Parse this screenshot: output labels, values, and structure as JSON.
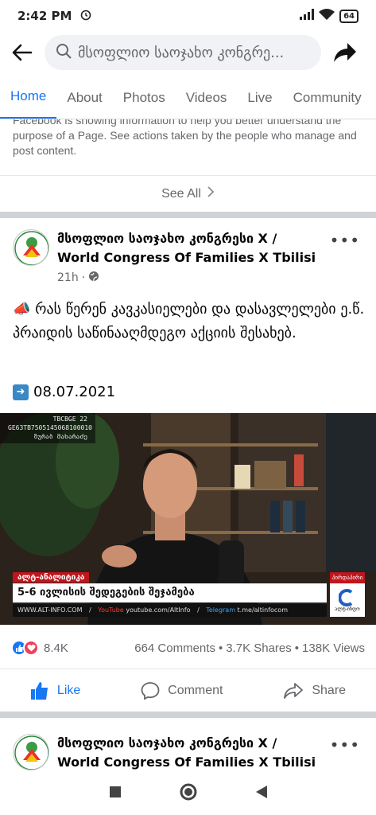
{
  "status": {
    "time": "2:42 PM",
    "battery": "64"
  },
  "search": {
    "query": "მსოფლიო საოჯახო კონგრე..."
  },
  "tabs": [
    {
      "label": "Home",
      "active": true
    },
    {
      "label": "About"
    },
    {
      "label": "Photos"
    },
    {
      "label": "Videos"
    },
    {
      "label": "Live"
    },
    {
      "label": "Community"
    }
  ],
  "info": {
    "partial_line": "Facebook is showing information to help you better understand the",
    "text": "purpose of a Page. See actions taken by the people who manage and post content."
  },
  "see_all": "See All",
  "post": {
    "page_name_line1": "მსოფლიო საოჯახო კონგრესი X /",
    "page_name_line2": "World Congress Of Families X Tbilisi",
    "time": "21h",
    "text": "📣 რას წერენ კავკასიელები და დასავლელები ე.წ. პრაიდის საწინააღმდეგო აქციის შესახებ.",
    "date": "08.07.2021",
    "video": {
      "bank_line1": "TBCBGE 22",
      "bank_line2": "GE63TB7505145068100010",
      "bank_line3": "ზურაბ მახარაძე",
      "tag": "ალტ-ანალიტიკა",
      "headline": "5-6 ივლისის შედეგების შეჯამება",
      "site": "WWW.ALT-INFO.COM",
      "youtube_label": "YouTube",
      "youtube_url": "youtube.com/AltInfo",
      "telegram_label": "Telegram",
      "telegram_url": "t.me/altinfocom",
      "badge_top": "პირდაპირი",
      "badge_bottom": "ალტ-ინფო"
    },
    "reactions": "8.4K",
    "comments": "664 Comments",
    "shares": "3.7K Shares",
    "views": "138K Views",
    "actions": {
      "like": "Like",
      "comment": "Comment",
      "share": "Share"
    }
  },
  "next_post": {
    "page_name_line1": "მსოფლიო საოჯახო კონგრესი X /",
    "page_name_line2": "World Congress Of Families X Tbilisi"
  },
  "colors": {
    "accent": "#1877f2",
    "divider": "#cfd2d6",
    "love": "#f33e58"
  }
}
